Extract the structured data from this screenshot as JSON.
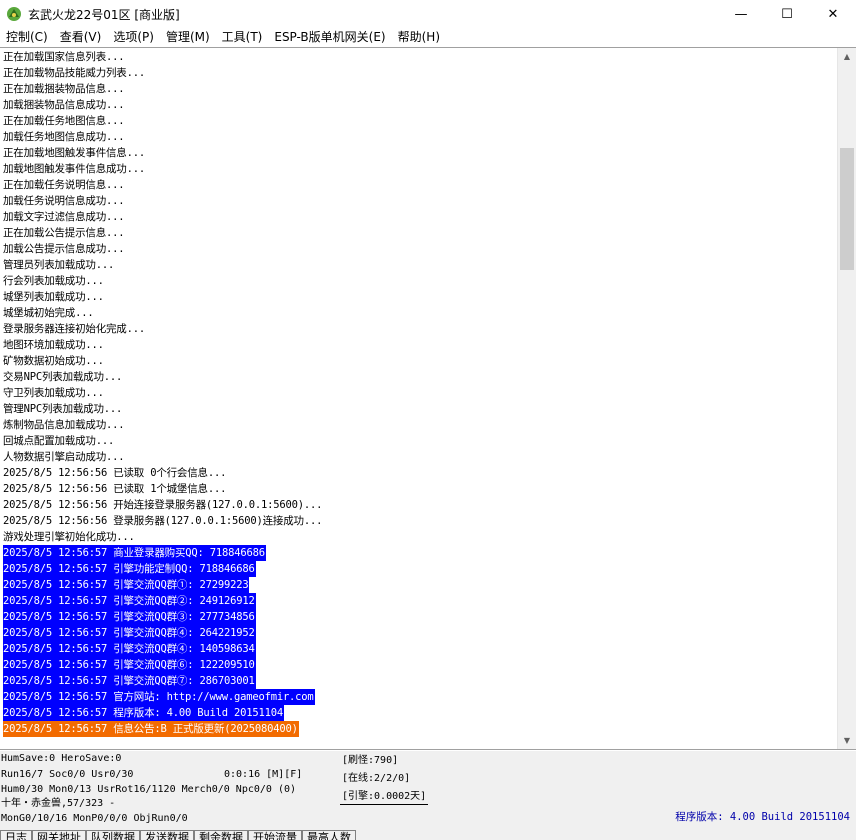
{
  "window": {
    "title": "玄武火龙22号01区 [商业版]",
    "icon": "dragon-icon",
    "minimize": "—",
    "maximize": "☐",
    "close": "✕"
  },
  "menu": [
    {
      "label": "控制(C)"
    },
    {
      "label": "查看(V)"
    },
    {
      "label": "选项(P)"
    },
    {
      "label": "管理(M)"
    },
    {
      "label": "工具(T)"
    },
    {
      "label": "ESP-B版单机网关(E)"
    },
    {
      "label": "帮助(H)"
    }
  ],
  "log": [
    {
      "text": "正在加载国家信息列表...",
      "style": "plain"
    },
    {
      "text": "正在加载物品技能威力列表...",
      "style": "plain"
    },
    {
      "text": "正在加载捆装物品信息...",
      "style": "plain"
    },
    {
      "text": "加载捆装物品信息成功...",
      "style": "plain"
    },
    {
      "text": "正在加载任务地图信息...",
      "style": "plain"
    },
    {
      "text": "加载任务地图信息成功...",
      "style": "plain"
    },
    {
      "text": "正在加载地图触发事件信息...",
      "style": "plain"
    },
    {
      "text": "加载地图触发事件信息成功...",
      "style": "plain"
    },
    {
      "text": "正在加载任务说明信息...",
      "style": "plain"
    },
    {
      "text": "加载任务说明信息成功...",
      "style": "plain"
    },
    {
      "text": "加载文字过滤信息成功...",
      "style": "plain"
    },
    {
      "text": "正在加载公告提示信息...",
      "style": "plain"
    },
    {
      "text": "加载公告提示信息成功...",
      "style": "plain"
    },
    {
      "text": "管理员列表加载成功...",
      "style": "plain"
    },
    {
      "text": "行会列表加载成功...",
      "style": "plain"
    },
    {
      "text": "城堡列表加载成功...",
      "style": "plain"
    },
    {
      "text": "城堡城初始完成...",
      "style": "plain"
    },
    {
      "text": "登录服务器连接初始化完成...",
      "style": "plain"
    },
    {
      "text": "地图环境加载成功...",
      "style": "plain"
    },
    {
      "text": "矿物数据初始成功...",
      "style": "plain"
    },
    {
      "text": "交易NPC列表加载成功...",
      "style": "plain"
    },
    {
      "text": "守卫列表加载成功...",
      "style": "plain"
    },
    {
      "text": "管理NPC列表加载成功...",
      "style": "plain"
    },
    {
      "text": "炼制物品信息加载成功...",
      "style": "plain"
    },
    {
      "text": "回城点配置加载成功...",
      "style": "plain"
    },
    {
      "text": "人物数据引擎启动成功...",
      "style": "plain"
    },
    {
      "text": "2025/8/5 12:56:56 已读取 0个行会信息...",
      "style": "plain"
    },
    {
      "text": "2025/8/5 12:56:56 已读取 1个城堡信息...",
      "style": "plain"
    },
    {
      "text": "2025/8/5 12:56:56 开始连接登录服务器(127.0.0.1:5600)...",
      "style": "plain"
    },
    {
      "text": "2025/8/5 12:56:56 登录服务器(127.0.0.1:5600)连接成功...",
      "style": "plain"
    },
    {
      "text": "游戏处理引擎初始化成功...",
      "style": "plain"
    },
    {
      "text": "2025/8/5 12:56:57 商业登录器购买QQ: 718846686",
      "style": "blue"
    },
    {
      "text": "2025/8/5 12:56:57 引擎功能定制QQ: 718846686",
      "style": "blue"
    },
    {
      "text": "2025/8/5 12:56:57 引擎交流QQ群①: 27299223",
      "style": "blue"
    },
    {
      "text": "2025/8/5 12:56:57 引擎交流QQ群②: 249126912",
      "style": "blue"
    },
    {
      "text": "2025/8/5 12:56:57 引擎交流QQ群③: 277734856",
      "style": "blue"
    },
    {
      "text": "2025/8/5 12:56:57 引擎交流QQ群④: 264221952",
      "style": "blue"
    },
    {
      "text": "2025/8/5 12:56:57 引擎交流QQ群④: 140598634",
      "style": "blue"
    },
    {
      "text": "2025/8/5 12:56:57 引擎交流QQ群⑥: 122209510",
      "style": "blue"
    },
    {
      "text": "2025/8/5 12:56:57 引擎交流QQ群⑦: 286703001",
      "style": "blue"
    },
    {
      "text": "2025/8/5 12:56:57 官方网站: http://www.gameofmir.com",
      "style": "blue"
    },
    {
      "text": "2025/8/5 12:56:57 程序版本: 4.00 Build 20151104",
      "style": "blue"
    },
    {
      "text": "2025/8/5 12:56:57 信息公告:B 正式版更新(2025080400)",
      "style": "orange"
    }
  ],
  "scroll": {
    "up_icon": "▲",
    "down_icon": "▼"
  },
  "status": {
    "line1": "HumSave:0 HeroSave:0",
    "line2": "Run16/7 Soc0/0 Usr0/30",
    "time": "0:0:16 [M][F]",
    "line3": "Hum0/30 Mon0/13 UsrRot16/1120 Merch0/0 Npc0/0 (0)",
    "line4": "十年・赤金兽,57/323 -",
    "line5": "MonG0/10/16 MonP0/0/0 ObjRun0/0",
    "refresh": "[刷怪:790]",
    "online": "[在线:2/2/0]",
    "engine": "[引擎:0.0002天]",
    "version": "程序版本: 4.00 Build 20151104"
  },
  "tabs": [
    {
      "label": "日志"
    },
    {
      "label": "网关地址"
    },
    {
      "label": "队列数据"
    },
    {
      "label": "发送数据"
    },
    {
      "label": "剩余数据"
    },
    {
      "label": "开始流量"
    },
    {
      "label": "最高人数"
    }
  ]
}
